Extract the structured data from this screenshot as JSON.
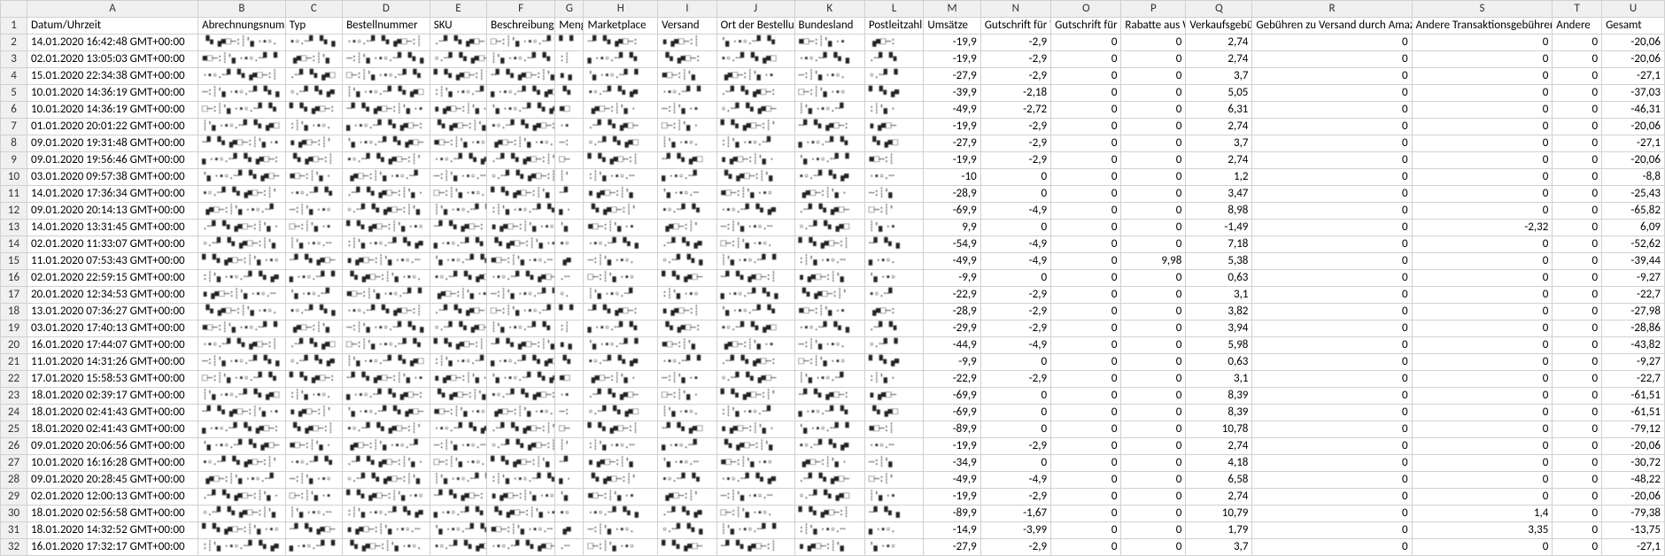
{
  "columns": [
    "A",
    "B",
    "C",
    "D",
    "E",
    "F",
    "G",
    "H",
    "I",
    "J",
    "K",
    "L",
    "M",
    "N",
    "O",
    "P",
    "Q",
    "R",
    "S",
    "T",
    "U"
  ],
  "headers": {
    "A": "Datum/Uhrzeit",
    "B": "Abrechnungsnummer",
    "C": "Typ",
    "D": "Bestellnummer",
    "E": "SKU",
    "F": "Beschreibung",
    "G": "Menge",
    "H": "Marketplace",
    "I": "Versand",
    "J": "Ort der Bestellung",
    "K": "Bundesland",
    "L": "Postleitzahl",
    "M": "Umsätze",
    "N": "Gutschrift für Versand",
    "O": "Gutschrift für Geschenkverpackung",
    "P": "Rabatte aus Werbeaktionen",
    "Q": "Verkaufsgebühren",
    "R": "Gebühren zu Versand durch Amazon",
    "S": "Andere Transaktionsgebühren",
    "T": "Andere",
    "U": "Gesamt"
  },
  "numericCols": [
    "M",
    "N",
    "O",
    "P",
    "Q",
    "R",
    "S",
    "T",
    "U"
  ],
  "obscuredCols": [
    "B",
    "C",
    "D",
    "E",
    "F",
    "G",
    "H",
    "I",
    "J",
    "K",
    "L"
  ],
  "rows": [
    {
      "A": "14.01.2020 16:42:48 GMT+00:00",
      "M": "-19,9",
      "N": "-2,9",
      "O": "0",
      "P": "0",
      "Q": "2,74",
      "R": "0",
      "S": "0",
      "T": "0",
      "U": "-20,06"
    },
    {
      "A": "02.01.2020 13:05:03 GMT+00:00",
      "M": "-19,9",
      "N": "-2,9",
      "O": "0",
      "P": "0",
      "Q": "2,74",
      "R": "0",
      "S": "0",
      "T": "0",
      "U": "-20,06"
    },
    {
      "A": "15.01.2020 22:34:38 GMT+00:00",
      "M": "-27,9",
      "N": "-2,9",
      "O": "0",
      "P": "0",
      "Q": "3,7",
      "R": "0",
      "S": "0",
      "T": "0",
      "U": "-27,1"
    },
    {
      "A": "10.01.2020 14:36:19 GMT+00:00",
      "M": "-39,9",
      "N": "-2,18",
      "O": "0",
      "P": "0",
      "Q": "5,05",
      "R": "0",
      "S": "0",
      "T": "0",
      "U": "-37,03"
    },
    {
      "A": "10.01.2020 14:36:19 GMT+00:00",
      "M": "-49,9",
      "N": "-2,72",
      "O": "0",
      "P": "0",
      "Q": "6,31",
      "R": "0",
      "S": "0",
      "T": "0",
      "U": "-46,31"
    },
    {
      "A": "01.01.2020 20:01:22 GMT+00:00",
      "M": "-19,9",
      "N": "-2,9",
      "O": "0",
      "P": "0",
      "Q": "2,74",
      "R": "0",
      "S": "0",
      "T": "0",
      "U": "-20,06"
    },
    {
      "A": "09.01.2020 19:31:48 GMT+00:00",
      "M": "-27,9",
      "N": "-2,9",
      "O": "0",
      "P": "0",
      "Q": "3,7",
      "R": "0",
      "S": "0",
      "T": "0",
      "U": "-27,1"
    },
    {
      "A": "09.01.2020 19:56:46 GMT+00:00",
      "M": "-19,9",
      "N": "-2,9",
      "O": "0",
      "P": "0",
      "Q": "2,74",
      "R": "0",
      "S": "0",
      "T": "0",
      "U": "-20,06"
    },
    {
      "A": "03.01.2020 09:57:38 GMT+00:00",
      "M": "-10",
      "N": "0",
      "O": "0",
      "P": "0",
      "Q": "1,2",
      "R": "0",
      "S": "0",
      "T": "0",
      "U": "-8,8"
    },
    {
      "A": "14.01.2020 17:36:34 GMT+00:00",
      "M": "-28,9",
      "N": "0",
      "O": "0",
      "P": "0",
      "Q": "3,47",
      "R": "0",
      "S": "0",
      "T": "0",
      "U": "-25,43"
    },
    {
      "A": "09.01.2020 20:14:13 GMT+00:00",
      "M": "-69,9",
      "N": "-4,9",
      "O": "0",
      "P": "0",
      "Q": "8,98",
      "R": "0",
      "S": "0",
      "T": "0",
      "U": "-65,82"
    },
    {
      "A": "14.01.2020 13:31:45 GMT+00:00",
      "M": "9,9",
      "N": "0",
      "O": "0",
      "P": "0",
      "Q": "-1,49",
      "R": "0",
      "S": "-2,32",
      "T": "0",
      "U": "6,09"
    },
    {
      "A": "02.01.2020 11:33:07 GMT+00:00",
      "M": "-54,9",
      "N": "-4,9",
      "O": "0",
      "P": "0",
      "Q": "7,18",
      "R": "0",
      "S": "0",
      "T": "0",
      "U": "-52,62"
    },
    {
      "A": "11.01.2020 07:53:43 GMT+00:00",
      "M": "-49,9",
      "N": "-4,9",
      "O": "0",
      "P": "9,98",
      "Q": "5,38",
      "R": "0",
      "S": "0",
      "T": "0",
      "U": "-39,44"
    },
    {
      "A": "02.01.2020 22:59:15 GMT+00:00",
      "M": "-9,9",
      "N": "0",
      "O": "0",
      "P": "0",
      "Q": "0,63",
      "R": "0",
      "S": "0",
      "T": "0",
      "U": "-9,27"
    },
    {
      "A": "20.01.2020 12:34:53 GMT+00:00",
      "M": "-22,9",
      "N": "-2,9",
      "O": "0",
      "P": "0",
      "Q": "3,1",
      "R": "0",
      "S": "0",
      "T": "0",
      "U": "-22,7"
    },
    {
      "A": "13.01.2020 07:36:27 GMT+00:00",
      "M": "-28,9",
      "N": "-2,9",
      "O": "0",
      "P": "0",
      "Q": "3,82",
      "R": "0",
      "S": "0",
      "T": "0",
      "U": "-27,98"
    },
    {
      "A": "03.01.2020 17:40:13 GMT+00:00",
      "M": "-29,9",
      "N": "-2,9",
      "O": "0",
      "P": "0",
      "Q": "3,94",
      "R": "0",
      "S": "0",
      "T": "0",
      "U": "-28,86"
    },
    {
      "A": "16.01.2020 17:44:07 GMT+00:00",
      "M": "-44,9",
      "N": "-4,9",
      "O": "0",
      "P": "0",
      "Q": "5,98",
      "R": "0",
      "S": "0",
      "T": "0",
      "U": "-43,82"
    },
    {
      "A": "11.01.2020 14:31:26 GMT+00:00",
      "M": "-9,9",
      "N": "0",
      "O": "0",
      "P": "0",
      "Q": "0,63",
      "R": "0",
      "S": "0",
      "T": "0",
      "U": "-9,27"
    },
    {
      "A": "17.01.2020 15:58:53 GMT+00:00",
      "M": "-22,9",
      "N": "-2,9",
      "O": "0",
      "P": "0",
      "Q": "3,1",
      "R": "0",
      "S": "0",
      "T": "0",
      "U": "-22,7"
    },
    {
      "A": "18.01.2020 02:39:17 GMT+00:00",
      "M": "-69,9",
      "N": "0",
      "O": "0",
      "P": "0",
      "Q": "8,39",
      "R": "0",
      "S": "0",
      "T": "0",
      "U": "-61,51"
    },
    {
      "A": "18.01.2020 02:41:43 GMT+00:00",
      "M": "-69,9",
      "N": "0",
      "O": "0",
      "P": "0",
      "Q": "8,39",
      "R": "0",
      "S": "0",
      "T": "0",
      "U": "-61,51"
    },
    {
      "A": "18.01.2020 02:41:43 GMT+00:00",
      "M": "-89,9",
      "N": "0",
      "O": "0",
      "P": "0",
      "Q": "10,78",
      "R": "0",
      "S": "0",
      "T": "0",
      "U": "-79,12"
    },
    {
      "A": "09.01.2020 20:06:56 GMT+00:00",
      "M": "-19,9",
      "N": "-2,9",
      "O": "0",
      "P": "0",
      "Q": "2,74",
      "R": "0",
      "S": "0",
      "T": "0",
      "U": "-20,06"
    },
    {
      "A": "10.01.2020 16:16:28 GMT+00:00",
      "M": "-34,9",
      "N": "0",
      "O": "0",
      "P": "0",
      "Q": "4,18",
      "R": "0",
      "S": "0",
      "T": "0",
      "U": "-30,72"
    },
    {
      "A": "09.01.2020 20:28:45 GMT+00:00",
      "M": "-49,9",
      "N": "-4,9",
      "O": "0",
      "P": "0",
      "Q": "6,58",
      "R": "0",
      "S": "0",
      "T": "0",
      "U": "-48,22"
    },
    {
      "A": "02.01.2020 12:00:13 GMT+00:00",
      "M": "-19,9",
      "N": "-2,9",
      "O": "0",
      "P": "0",
      "Q": "2,74",
      "R": "0",
      "S": "0",
      "T": "0",
      "U": "-20,06"
    },
    {
      "A": "18.01.2020 02:56:58 GMT+00:00",
      "M": "-89,9",
      "N": "-1,67",
      "O": "0",
      "P": "0",
      "Q": "10,79",
      "R": "0",
      "S": "1,4",
      "T": "0",
      "U": "-79,38"
    },
    {
      "A": "18.01.2020 14:32:52 GMT+00:00",
      "M": "-14,9",
      "N": "-3,99",
      "O": "0",
      "P": "0",
      "Q": "1,79",
      "R": "0",
      "S": "3,35",
      "T": "0",
      "U": "-13,75"
    },
    {
      "A": "16.01.2020 17:32:17 GMT+00:00",
      "M": "-27,9",
      "N": "-2,9",
      "O": "0",
      "P": "0",
      "Q": "3,7",
      "R": "0",
      "S": "0",
      "T": "0",
      "U": "-27,1"
    }
  ]
}
